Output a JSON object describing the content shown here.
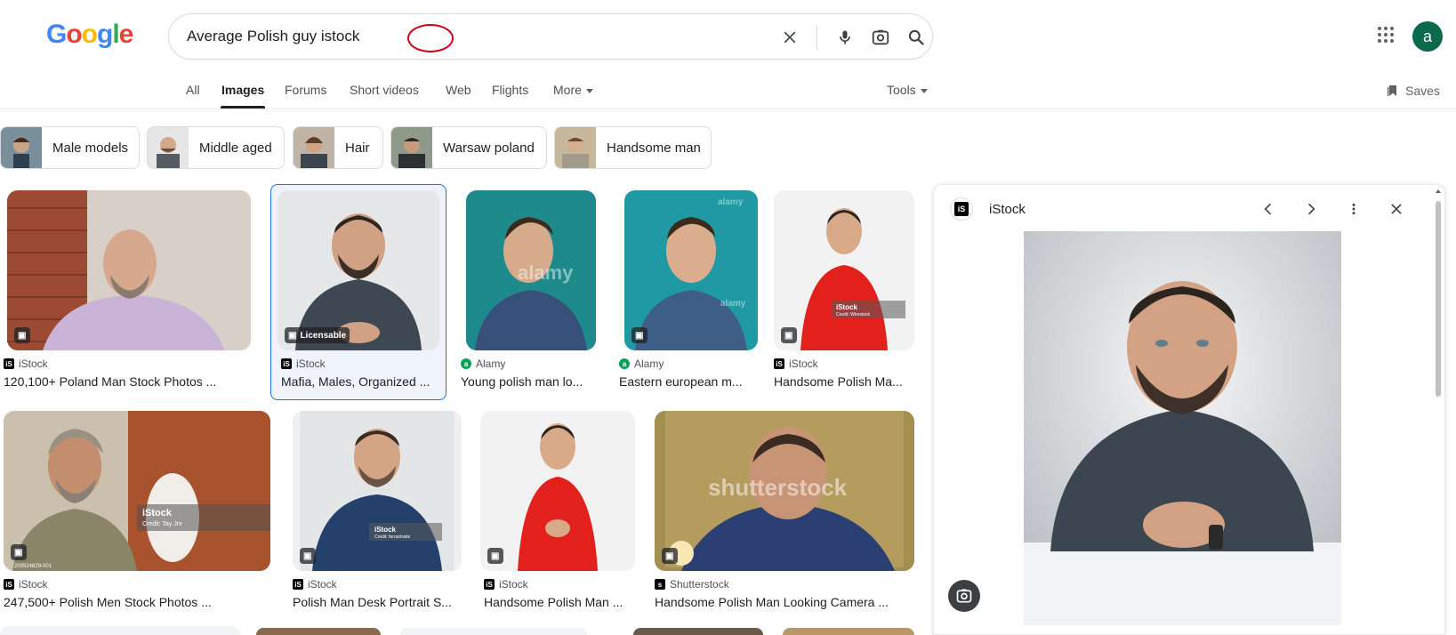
{
  "logo": {
    "text": "Google",
    "colors": [
      "#4285F4",
      "#EA4335",
      "#FBBC05",
      "#4285F4",
      "#34A853",
      "#EA4335"
    ]
  },
  "search": {
    "query": "Average Polish guy istock",
    "clear_icon": "close-icon",
    "voice_icon": "mic-icon",
    "lens_icon": "lens-icon",
    "search_icon": "search-icon"
  },
  "header": {
    "apps_icon": "apps-grid-icon",
    "avatar_letter": "a",
    "avatar_color": "#0b6a4b"
  },
  "tabs": {
    "items": [
      {
        "label": "All",
        "active": false
      },
      {
        "label": "Images",
        "active": true
      },
      {
        "label": "Forums",
        "active": false
      },
      {
        "label": "Short videos",
        "active": false
      },
      {
        "label": "Web",
        "active": false
      },
      {
        "label": "Flights",
        "active": false
      },
      {
        "label": "More",
        "active": false
      }
    ],
    "tools": "Tools",
    "saves": "Saves"
  },
  "chips": [
    {
      "label": "Male models"
    },
    {
      "label": "Middle aged"
    },
    {
      "label": "Hair"
    },
    {
      "label": "Warsaw poland"
    },
    {
      "label": "Handsome man"
    }
  ],
  "results": [
    {
      "source": "iStock",
      "title": "120,100+ Poland Man Stock Photos ...",
      "badge": ""
    },
    {
      "source": "iStock",
      "title": "Mafia, Males, Organized ...",
      "badge": "Licensable",
      "selected": true
    },
    {
      "source": "Alamy",
      "title": "Young polish man lo...",
      "badge": ""
    },
    {
      "source": "Alamy",
      "title": "Eastern european m...",
      "badge": ""
    },
    {
      "source": "iStock",
      "title": "Handsome Polish Ma...",
      "badge": ""
    },
    {
      "source": "iStock",
      "title": "247,500+ Polish Men Stock Photos ...",
      "badge": ""
    },
    {
      "source": "iStock",
      "title": "Polish Man Desk Portrait S...",
      "badge": ""
    },
    {
      "source": "iStock",
      "title": "Handsome Polish Man ...",
      "badge": ""
    },
    {
      "source": "Shutterstock",
      "title": "Handsome Polish Man Looking Camera ...",
      "badge": ""
    }
  ],
  "watermarks": {
    "alamy": "alamy",
    "istock": "iStock",
    "shutterstock": "shutterstock",
    "istock_credit_1": "Credit: Tay Jnr",
    "istock_credit_2": "Credit: ferrantraite",
    "istock_credit_3": "Credit: Wirestock",
    "stock_id": "200524629-001"
  },
  "panel": {
    "source": "iStock",
    "prev_icon": "chevron-left-icon",
    "next_icon": "chevron-right-icon",
    "more_icon": "more-vert-icon",
    "close_icon": "close-icon",
    "lens_icon": "lens-icon"
  }
}
